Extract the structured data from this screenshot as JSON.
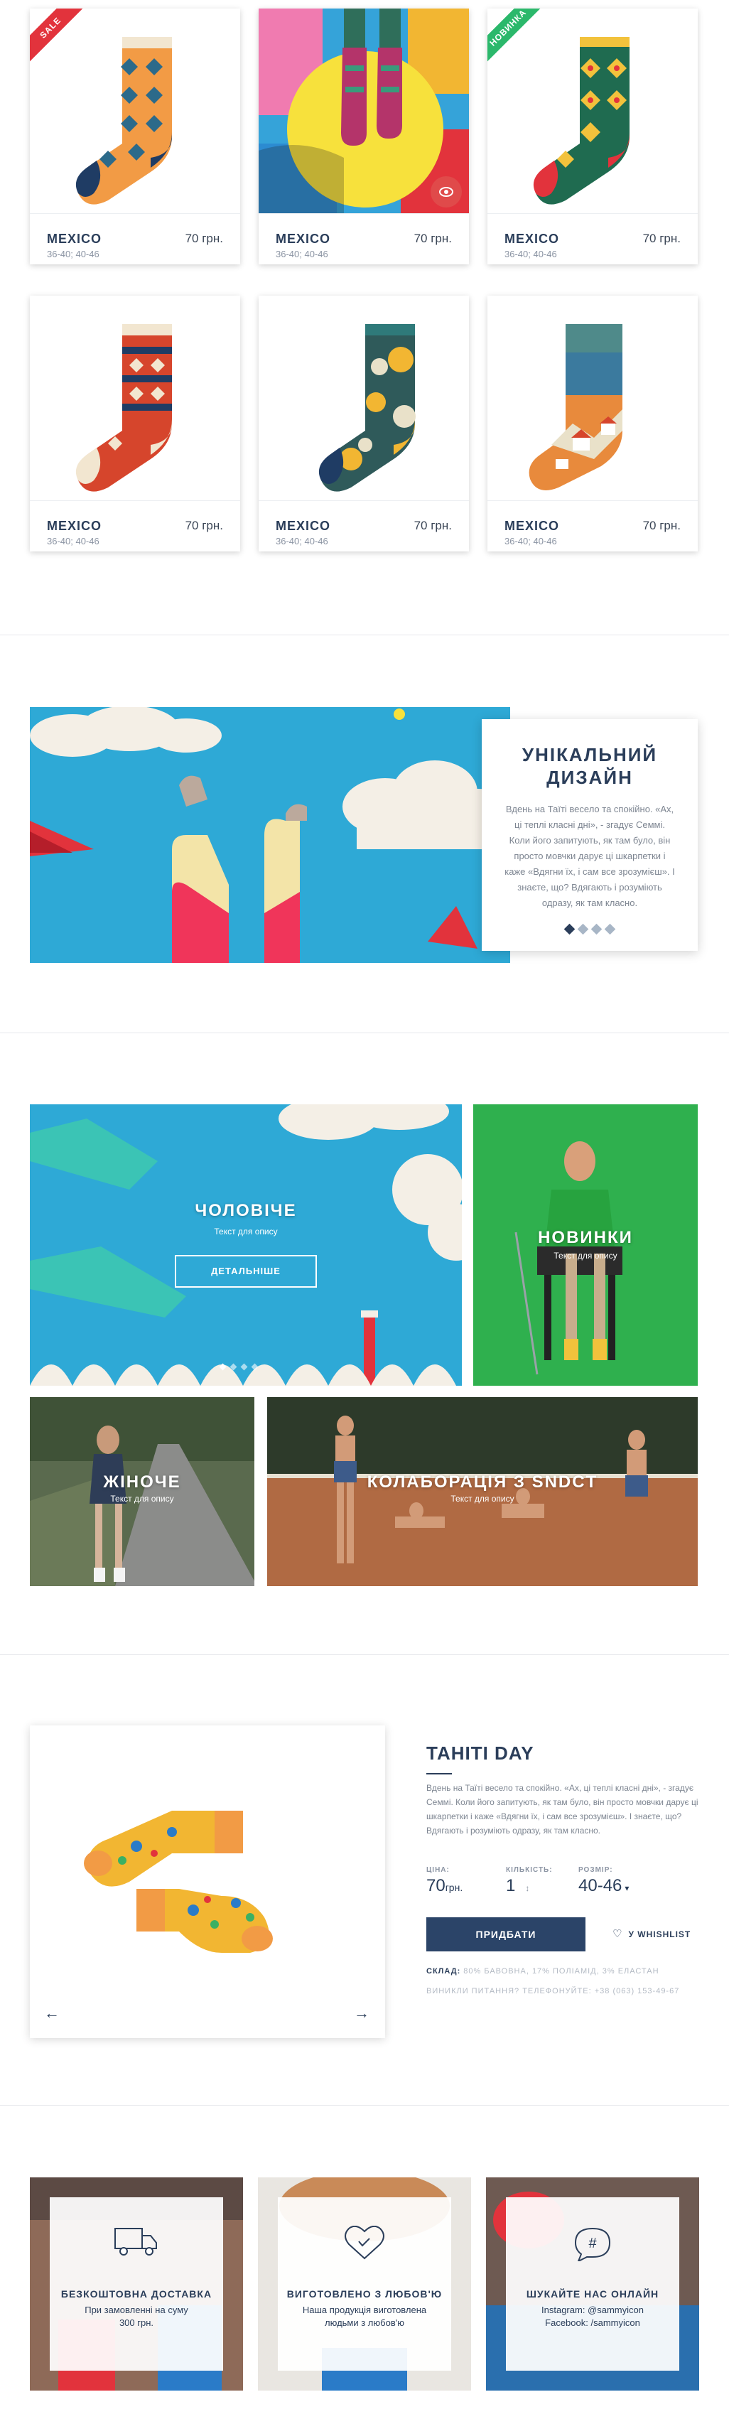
{
  "products": [
    {
      "name": "MEXICO",
      "price": "70 грн.",
      "sizes": "36-40; 40-46",
      "ribbon": "SALE",
      "ribbon_color": "#e2333c"
    },
    {
      "name": "MEXICO",
      "price": "70 грн.",
      "sizes": "36-40; 40-46",
      "ribbon": "",
      "ribbon_color": ""
    },
    {
      "name": "MEXICO",
      "price": "70 грн.",
      "sizes": "36-40; 40-46",
      "ribbon": "НОВИНКА",
      "ribbon_color": "#2bb86b"
    },
    {
      "name": "MEXICO",
      "price": "70 грн.",
      "sizes": "36-40; 40-46",
      "ribbon": "",
      "ribbon_color": ""
    },
    {
      "name": "MEXICO",
      "price": "70 грн.",
      "sizes": "36-40; 40-46",
      "ribbon": "",
      "ribbon_color": ""
    },
    {
      "name": "MEXICO",
      "price": "70 грн.",
      "sizes": "36-40; 40-46",
      "ribbon": "",
      "ribbon_color": ""
    }
  ],
  "unique": {
    "title": "УНІКАЛЬНИЙ ДИЗАЙН",
    "text": "Вдень на Таїті весело та спокійно. «Ах, ці теплі класні дні», - згадує Семмі. Коли його запитують, як там було, він просто мовчки дарує ці шкарпетки і каже «Вдягни їх, і сам все зрозумієш». І знаєте, що? Вдягають і розуміють одразу, як там класно.",
    "slides": 4,
    "active": 0
  },
  "categories": {
    "men": {
      "title": "ЧОЛОВІЧЕ",
      "sub": "Текст для опису",
      "button": "ДЕТАЛЬНІШЕ"
    },
    "new": {
      "title": "НОВИНКИ",
      "sub": "Текст для опису"
    },
    "women": {
      "title": "ЖІНОЧЕ",
      "sub": "Текст для опису"
    },
    "collab": {
      "title": "КОЛАБОРАЦІЯ З SNDCT",
      "sub": "Текст для опису"
    }
  },
  "detail": {
    "title": "TAHITI DAY",
    "text": "Вдень на Таїті весело та  спокійно. «Ах, ці теплі класні дні», - згадує Семмі. Коли його запитують, як там було, він просто мовчки дарує ці шкарпетки і каже «Вдягни їх, і сам все зрозумієш». І знаєте, що? Вдягають і розуміють одразу, як там класно.",
    "price_label": "ЦІНА:",
    "price_value": "70",
    "price_unit": "грн.",
    "qty_label": "КІЛЬКІСТЬ:",
    "qty_value": "1",
    "size_label": "РОЗМІР:",
    "size_value": "40-46",
    "buy": "ПРИДБАТИ",
    "wishlist": "У WHISHLIST",
    "stock_label": "СКЛАД:",
    "stock_value": "80% БАВОВНА, 17% ПОЛІАМІД, 3% ЕЛАСТАН",
    "phone_text": "ВИНИКЛИ ПИТАННЯ? ТЕЛЕФОНУЙТЕ: +38 (063) 153-49-67"
  },
  "features": [
    {
      "icon": "truck-icon",
      "title": "БЕЗКОШТОВНА ДОСТАВКА",
      "text1": "При замовленні на суму",
      "text2": "300 грн."
    },
    {
      "icon": "heart-icon",
      "title": "ВИГОТОВЛЕНО З ЛЮБОВ'Ю",
      "text1": "Наша продукція виготовлена",
      "text2": "людьми з любов'ю"
    },
    {
      "icon": "hashtag-chat-icon",
      "title": "ШУКАЙТЕ НАС ОНЛАЙН",
      "text1": "Instagram: @sammyicon",
      "text2": "Facebook: /sammyicon"
    }
  ],
  "colors": {
    "navy": "#2b3e5a",
    "button": "#2b4468",
    "accent_red": "#e04a4a",
    "green": "#2bb86b",
    "sky": "#2aa7d3"
  }
}
